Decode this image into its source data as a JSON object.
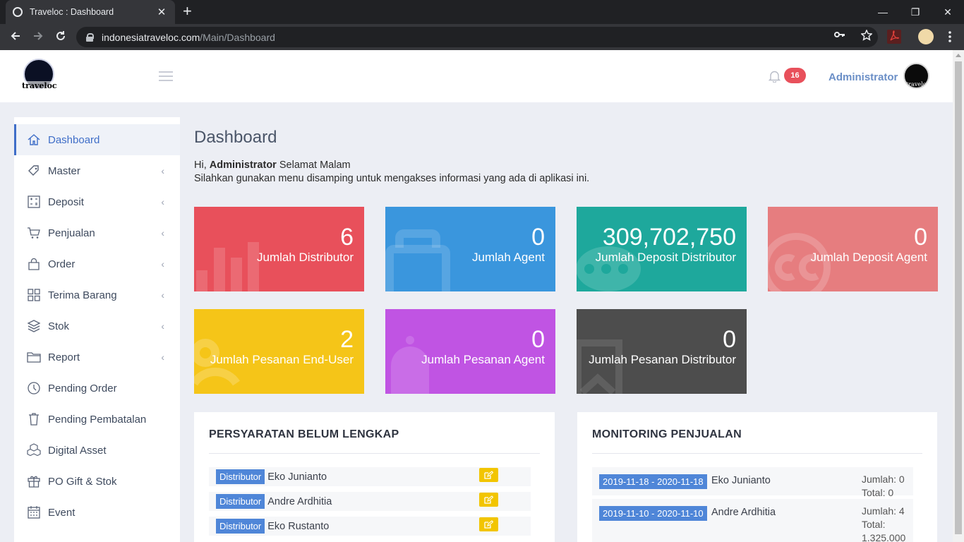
{
  "browser": {
    "tab_title": "Traveloc : Dashboard",
    "tab_close": "✕",
    "new_tab": "+",
    "url_host": "indonesiatraveloc.com",
    "url_path": "/Main/Dashboard",
    "win_min": "—",
    "win_max": "❐",
    "win_close": "✕"
  },
  "header": {
    "logo_text": "traveloc",
    "notification_count": "16",
    "user_name": "Administrator"
  },
  "sidebar": {
    "items": [
      {
        "label": "Dashboard",
        "icon": "home-icon",
        "active": true,
        "has_submenu": false
      },
      {
        "label": "Master",
        "icon": "tag-icon",
        "has_submenu": true
      },
      {
        "label": "Deposit",
        "icon": "calculator-icon",
        "has_submenu": true
      },
      {
        "label": "Penjualan",
        "icon": "cart-icon",
        "has_submenu": true
      },
      {
        "label": "Order",
        "icon": "bag-icon",
        "has_submenu": true
      },
      {
        "label": "Terima Barang",
        "icon": "grid-icon",
        "has_submenu": true
      },
      {
        "label": "Stok",
        "icon": "layers-icon",
        "has_submenu": true
      },
      {
        "label": "Report",
        "icon": "folder-icon",
        "has_submenu": true
      },
      {
        "label": "Pending Order",
        "icon": "clock-icon",
        "has_submenu": false
      },
      {
        "label": "Pending Pembatalan",
        "icon": "trash-icon",
        "has_submenu": false
      },
      {
        "label": "Digital Asset",
        "icon": "cubes-icon",
        "has_submenu": false
      },
      {
        "label": "PO Gift & Stok",
        "icon": "gift-icon",
        "has_submenu": false
      },
      {
        "label": "Event",
        "icon": "calendar-icon",
        "has_submenu": false
      }
    ],
    "chevron": "‹"
  },
  "main": {
    "title": "Dashboard",
    "greeting_prefix": "Hi, ",
    "greeting_name": "Administrator",
    "greeting_suffix": " Selamat Malam",
    "instruction": "Silahkan gunakan menu disamping untuk mengakses informasi yang ada di aplikasi ini."
  },
  "stats": [
    {
      "value": "6",
      "label": "Jumlah Distributor",
      "color": "#e8505b"
    },
    {
      "value": "0",
      "label": "Jumlah Agent",
      "color": "#3a96dd"
    },
    {
      "value": "309,702,750",
      "label": "Jumlah Deposit Distributor",
      "color": "#1ea89c"
    },
    {
      "value": "0",
      "label": "Jumlah Deposit Agent",
      "color": "#e67d7f"
    },
    {
      "value": "2",
      "label": "Jumlah Pesanan End-User",
      "color": "#f5c518"
    },
    {
      "value": "0",
      "label": "Jumlah Pesanan Agent",
      "color": "#c054e3"
    },
    {
      "value": "0",
      "label": "Jumlah Pesanan Distributor",
      "color": "#4d4d4d"
    }
  ],
  "persyaratan": {
    "title": "PERSYARATAN BELUM LENGKAP",
    "rows": [
      {
        "tag": "Distributor",
        "name": "Eko Junianto"
      },
      {
        "tag": "Distributor",
        "name": "Andre Ardhitia"
      },
      {
        "tag": "Distributor",
        "name": "Eko Rustanto"
      }
    ]
  },
  "monitoring": {
    "title": "MONITORING PENJUALAN",
    "rows": [
      {
        "period": "2019-11-18 - 2020-11-18",
        "name": "Eko Junianto",
        "jumlah": "Jumlah: 0",
        "total": "Total: 0"
      },
      {
        "period": "2019-11-10 - 2020-11-10",
        "name": "Andre Ardhitia",
        "jumlah": "Jumlah: 4",
        "total": "Total:",
        "total_value": "1.325.000"
      }
    ]
  }
}
